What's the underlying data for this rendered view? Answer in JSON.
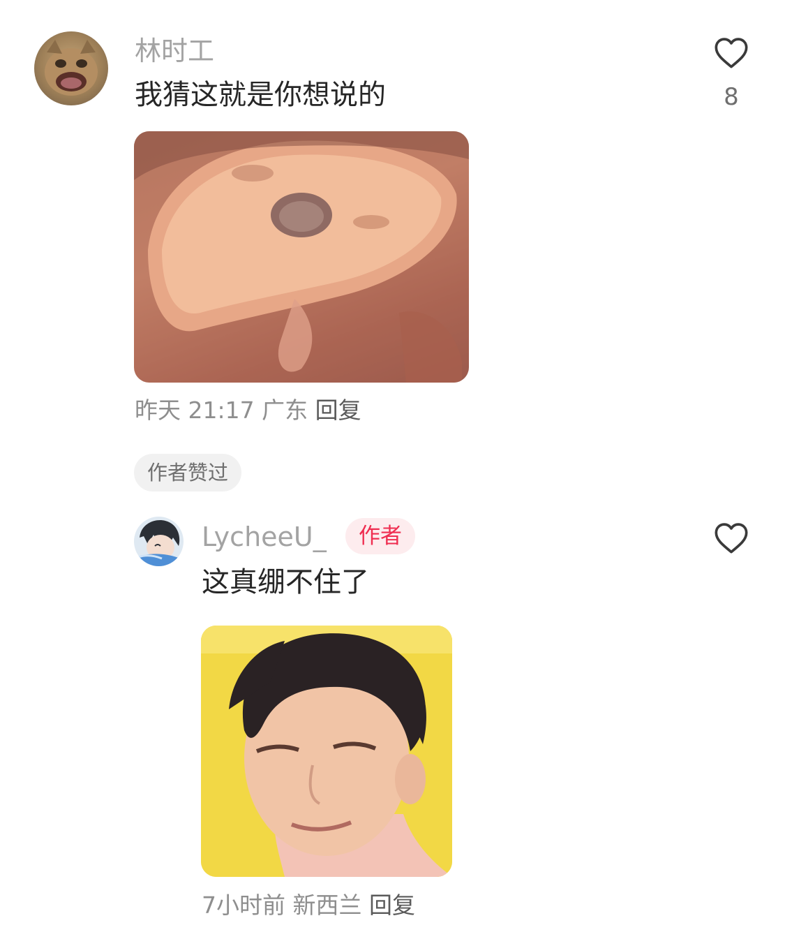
{
  "comments": [
    {
      "username": "林时工",
      "text": "我猜这就是你想说的",
      "time": "昨天 21:17",
      "location": "广东",
      "reply_label": "回复",
      "like_count": "8",
      "liked_tag": "作者赞过"
    },
    {
      "username": "LycheeU_",
      "author_badge": "作者",
      "text": "这真绷不住了",
      "time": "7小时前",
      "location": "新西兰",
      "reply_label": "回复"
    }
  ],
  "icons": {
    "like": "heart-outline-icon"
  },
  "colors": {
    "author_badge_text": "#ef2d50",
    "author_badge_bg": "#fdecee",
    "username": "#a3a3a3"
  }
}
